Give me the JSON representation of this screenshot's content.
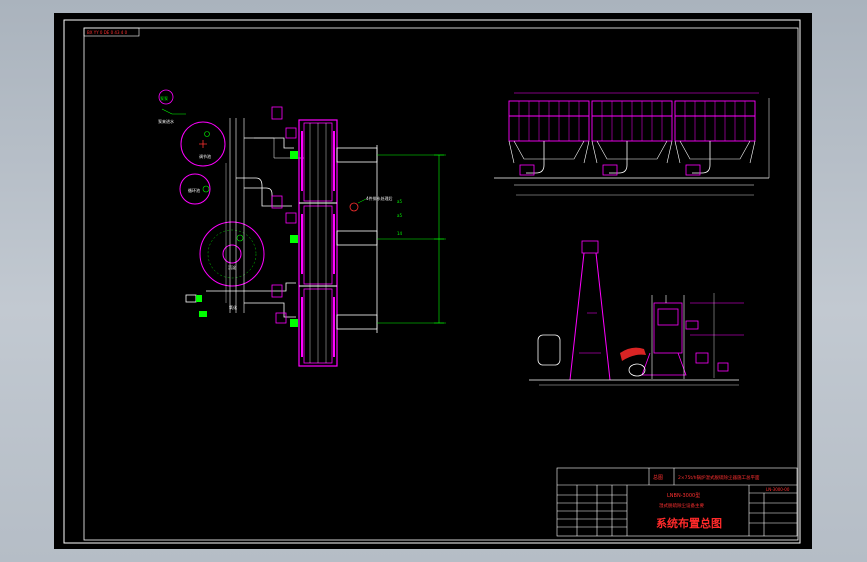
{
  "stamp_top_left": "BX YY 0 DE 0 43 4 0",
  "side_view": {
    "dim_labels": [
      "a5",
      "a5",
      "14"
    ],
    "note_label": "4件排水处理后"
  },
  "title_block": {
    "project_name": "2×75t/h锅炉湿式脱硫除尘器施工总平面",
    "drawing_code": "LNBN-3000型",
    "subtitle": "湿式脱硫除尘设备主要",
    "title": "系统布置总图",
    "label_left": "总图",
    "small_code": "LN-3000-00"
  },
  "colors": {
    "magenta": "#ff00ff",
    "green": "#00ff00",
    "white": "#ffffff",
    "red": "#ff2a2a",
    "yellow": "#ffff00",
    "cyan": "#00ffff"
  }
}
